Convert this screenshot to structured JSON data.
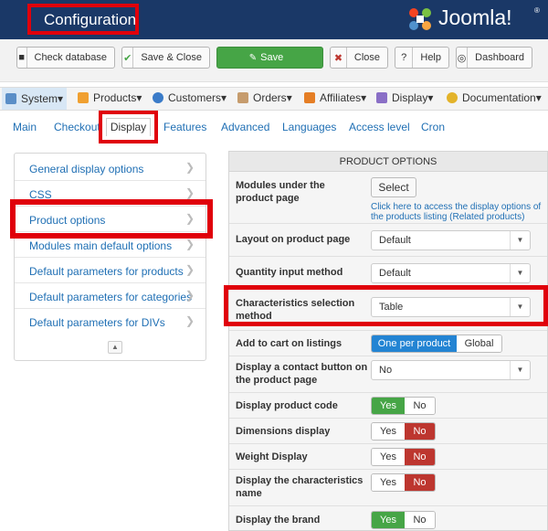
{
  "header": {
    "title": "Configuration",
    "logo_text": "Joomla!",
    "logo_sup": "®"
  },
  "toolbar": {
    "check_database": "Check database",
    "save_close": "Save & Close",
    "save": "Save",
    "close": "Close",
    "help": "Help",
    "dashboard": "Dashboard"
  },
  "menu": {
    "items": [
      "System",
      "Products",
      "Customers",
      "Orders",
      "Affiliates",
      "Display",
      "Documentation"
    ]
  },
  "tabs": [
    "Main",
    "Checkout",
    "Display",
    "Features",
    "Advanced",
    "Languages",
    "Access level",
    "Cron"
  ],
  "left_menu": [
    "General display options",
    "CSS",
    "Product options",
    "Modules main default options",
    "Default parameters for products",
    "Default parameters for categories",
    "Default parameters for DIVs"
  ],
  "product_options": {
    "header": "PRODUCT OPTIONS",
    "modules_label": "Modules under the product page",
    "select_button": "Select",
    "select_help": "Click here to access the display options of the products listing (Related products)",
    "layout_label": "Layout on product page",
    "layout_value": "Default",
    "quantity_label": "Quantity input method",
    "quantity_value": "Default",
    "chars_label": "Characteristics selection method",
    "chars_value": "Table",
    "cart_label": "Add to cart on listings",
    "cart_opt1": "One per product",
    "cart_opt2": "Global",
    "contact_label": "Display a contact button on the product page",
    "contact_value": "No",
    "code_label": "Display product code",
    "dimensions_label": "Dimensions display",
    "weight_label": "Weight Display",
    "charname_label": "Display the characteristics name",
    "brand_label": "Display the brand",
    "yes": "Yes",
    "no": "No"
  },
  "colors": {
    "header_bg": "#1a3867",
    "highlight": "#e0000b",
    "green": "#46a546",
    "red": "#bd362f",
    "blue": "#2384d3",
    "link": "#1f6fb4"
  }
}
